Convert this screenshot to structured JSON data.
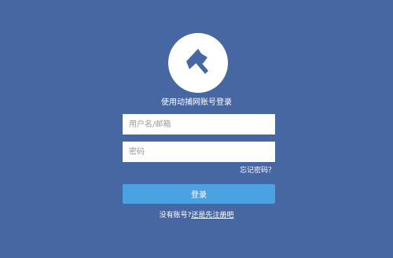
{
  "brand": {
    "logo_icon": "axe-icon",
    "subtitle": "使用动捕网账号登录"
  },
  "form": {
    "username_placeholder": "用户名/邮箱",
    "username_value": "",
    "password_placeholder": "密码",
    "password_value": "",
    "forgot_label": "忘记密码？",
    "login_label": "登录"
  },
  "footer": {
    "no_account_text": "没有账号?",
    "register_label": "还是先注册吧"
  },
  "colors": {
    "background": "#4767a3",
    "button": "#4aa2e0",
    "text": "#ffffff"
  }
}
